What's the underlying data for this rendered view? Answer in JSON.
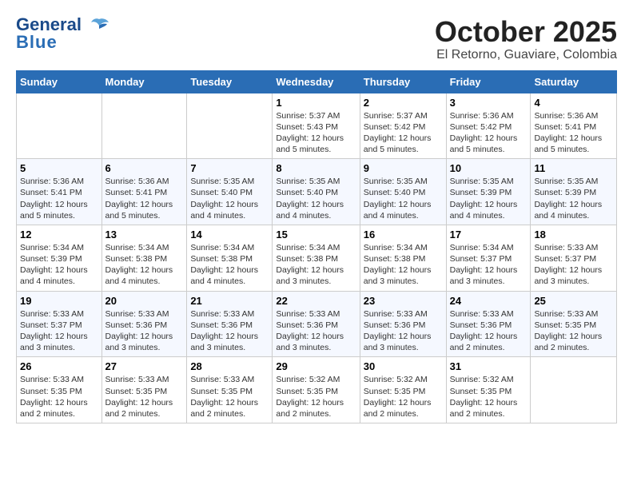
{
  "logo": {
    "line1": "General",
    "line2": "Blue"
  },
  "title": "October 2025",
  "subtitle": "El Retorno, Guaviare, Colombia",
  "days_of_week": [
    "Sunday",
    "Monday",
    "Tuesday",
    "Wednesday",
    "Thursday",
    "Friday",
    "Saturday"
  ],
  "weeks": [
    [
      {
        "day": "",
        "info": ""
      },
      {
        "day": "",
        "info": ""
      },
      {
        "day": "",
        "info": ""
      },
      {
        "day": "1",
        "info": "Sunrise: 5:37 AM\nSunset: 5:43 PM\nDaylight: 12 hours\nand 5 minutes."
      },
      {
        "day": "2",
        "info": "Sunrise: 5:37 AM\nSunset: 5:42 PM\nDaylight: 12 hours\nand 5 minutes."
      },
      {
        "day": "3",
        "info": "Sunrise: 5:36 AM\nSunset: 5:42 PM\nDaylight: 12 hours\nand 5 minutes."
      },
      {
        "day": "4",
        "info": "Sunrise: 5:36 AM\nSunset: 5:41 PM\nDaylight: 12 hours\nand 5 minutes."
      }
    ],
    [
      {
        "day": "5",
        "info": "Sunrise: 5:36 AM\nSunset: 5:41 PM\nDaylight: 12 hours\nand 5 minutes."
      },
      {
        "day": "6",
        "info": "Sunrise: 5:36 AM\nSunset: 5:41 PM\nDaylight: 12 hours\nand 5 minutes."
      },
      {
        "day": "7",
        "info": "Sunrise: 5:35 AM\nSunset: 5:40 PM\nDaylight: 12 hours\nand 4 minutes."
      },
      {
        "day": "8",
        "info": "Sunrise: 5:35 AM\nSunset: 5:40 PM\nDaylight: 12 hours\nand 4 minutes."
      },
      {
        "day": "9",
        "info": "Sunrise: 5:35 AM\nSunset: 5:40 PM\nDaylight: 12 hours\nand 4 minutes."
      },
      {
        "day": "10",
        "info": "Sunrise: 5:35 AM\nSunset: 5:39 PM\nDaylight: 12 hours\nand 4 minutes."
      },
      {
        "day": "11",
        "info": "Sunrise: 5:35 AM\nSunset: 5:39 PM\nDaylight: 12 hours\nand 4 minutes."
      }
    ],
    [
      {
        "day": "12",
        "info": "Sunrise: 5:34 AM\nSunset: 5:39 PM\nDaylight: 12 hours\nand 4 minutes."
      },
      {
        "day": "13",
        "info": "Sunrise: 5:34 AM\nSunset: 5:38 PM\nDaylight: 12 hours\nand 4 minutes."
      },
      {
        "day": "14",
        "info": "Sunrise: 5:34 AM\nSunset: 5:38 PM\nDaylight: 12 hours\nand 4 minutes."
      },
      {
        "day": "15",
        "info": "Sunrise: 5:34 AM\nSunset: 5:38 PM\nDaylight: 12 hours\nand 3 minutes."
      },
      {
        "day": "16",
        "info": "Sunrise: 5:34 AM\nSunset: 5:38 PM\nDaylight: 12 hours\nand 3 minutes."
      },
      {
        "day": "17",
        "info": "Sunrise: 5:34 AM\nSunset: 5:37 PM\nDaylight: 12 hours\nand 3 minutes."
      },
      {
        "day": "18",
        "info": "Sunrise: 5:33 AM\nSunset: 5:37 PM\nDaylight: 12 hours\nand 3 minutes."
      }
    ],
    [
      {
        "day": "19",
        "info": "Sunrise: 5:33 AM\nSunset: 5:37 PM\nDaylight: 12 hours\nand 3 minutes."
      },
      {
        "day": "20",
        "info": "Sunrise: 5:33 AM\nSunset: 5:36 PM\nDaylight: 12 hours\nand 3 minutes."
      },
      {
        "day": "21",
        "info": "Sunrise: 5:33 AM\nSunset: 5:36 PM\nDaylight: 12 hours\nand 3 minutes."
      },
      {
        "day": "22",
        "info": "Sunrise: 5:33 AM\nSunset: 5:36 PM\nDaylight: 12 hours\nand 3 minutes."
      },
      {
        "day": "23",
        "info": "Sunrise: 5:33 AM\nSunset: 5:36 PM\nDaylight: 12 hours\nand 3 minutes."
      },
      {
        "day": "24",
        "info": "Sunrise: 5:33 AM\nSunset: 5:36 PM\nDaylight: 12 hours\nand 2 minutes."
      },
      {
        "day": "25",
        "info": "Sunrise: 5:33 AM\nSunset: 5:35 PM\nDaylight: 12 hours\nand 2 minutes."
      }
    ],
    [
      {
        "day": "26",
        "info": "Sunrise: 5:33 AM\nSunset: 5:35 PM\nDaylight: 12 hours\nand 2 minutes."
      },
      {
        "day": "27",
        "info": "Sunrise: 5:33 AM\nSunset: 5:35 PM\nDaylight: 12 hours\nand 2 minutes."
      },
      {
        "day": "28",
        "info": "Sunrise: 5:33 AM\nSunset: 5:35 PM\nDaylight: 12 hours\nand 2 minutes."
      },
      {
        "day": "29",
        "info": "Sunrise: 5:32 AM\nSunset: 5:35 PM\nDaylight: 12 hours\nand 2 minutes."
      },
      {
        "day": "30",
        "info": "Sunrise: 5:32 AM\nSunset: 5:35 PM\nDaylight: 12 hours\nand 2 minutes."
      },
      {
        "day": "31",
        "info": "Sunrise: 5:32 AM\nSunset: 5:35 PM\nDaylight: 12 hours\nand 2 minutes."
      },
      {
        "day": "",
        "info": ""
      }
    ]
  ]
}
